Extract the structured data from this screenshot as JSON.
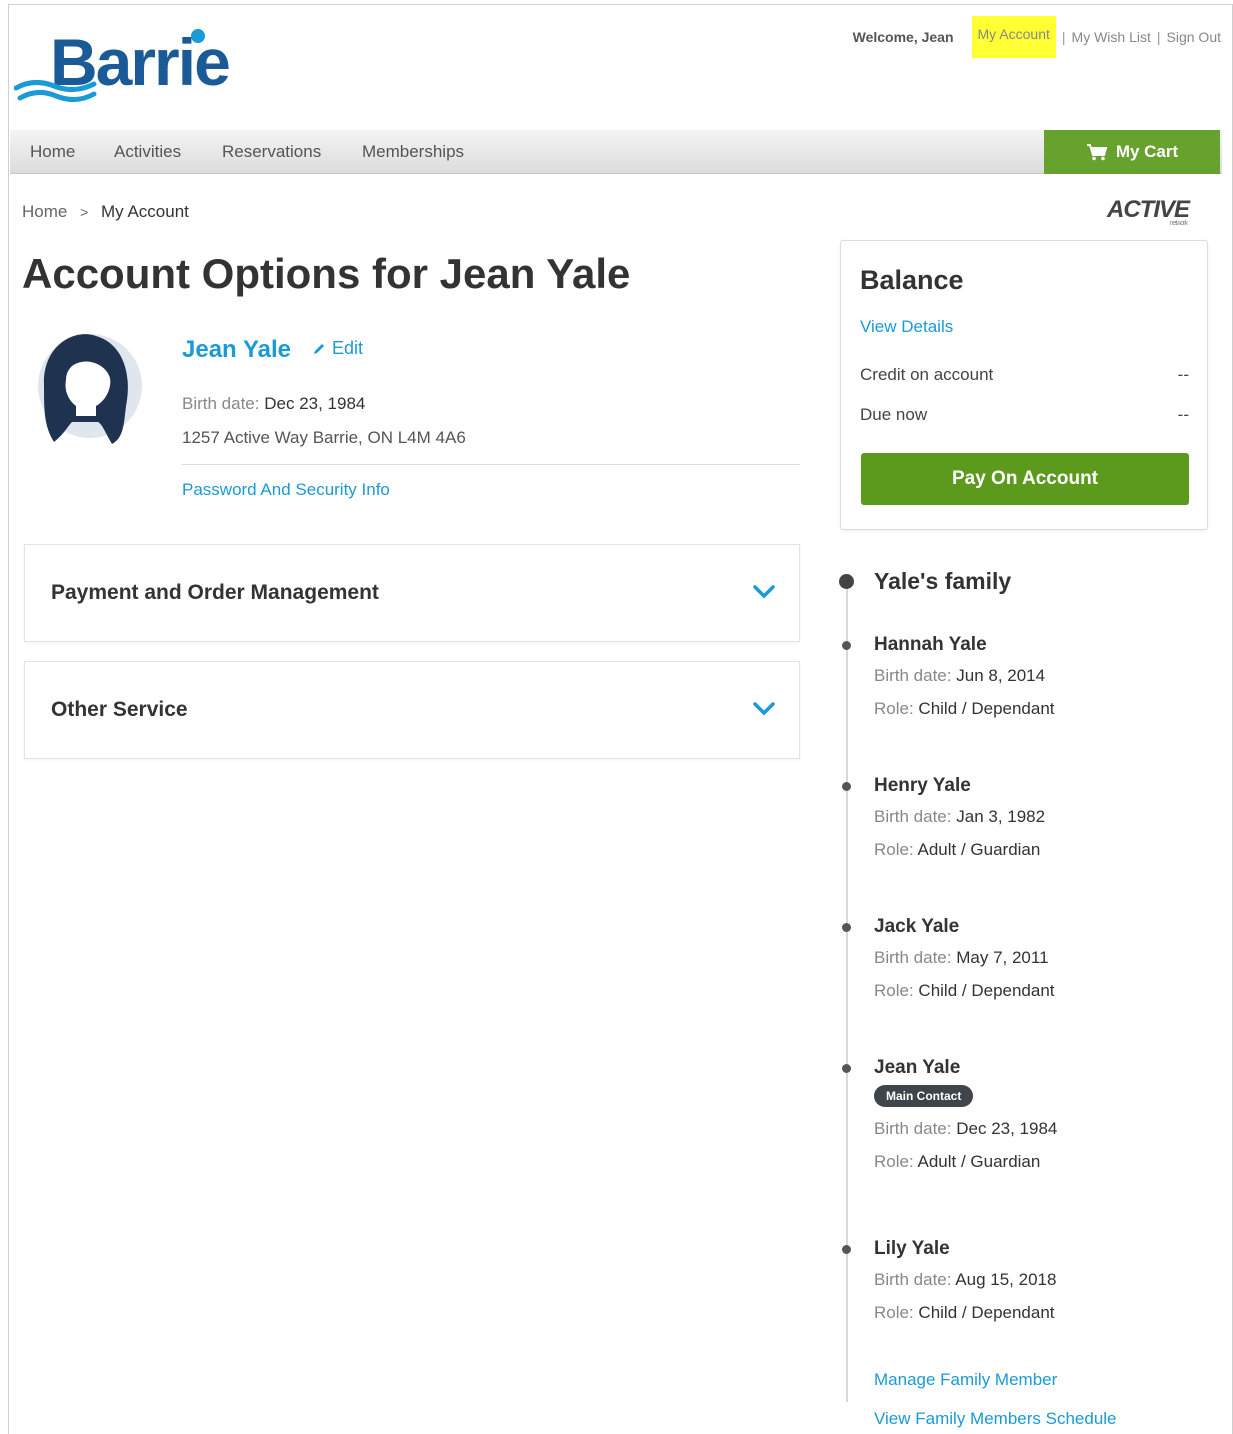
{
  "header": {
    "welcome": "Welcome, Jean",
    "my_account": "My Account",
    "sep1": "|",
    "my_wish_list": "My Wish List",
    "sep2": "|",
    "sign_out": "Sign Out"
  },
  "logo": {
    "text": "Barrie"
  },
  "nav": {
    "items": [
      "Home",
      "Activities",
      "Reservations",
      "Memberships"
    ],
    "cart_label": "My Cart"
  },
  "breadcrumb": {
    "home": "Home",
    "sep": ">",
    "current": "My Account"
  },
  "active_logo": {
    "text": "ACTIVE",
    "sub": "network"
  },
  "page_title": "Account Options for Jean Yale",
  "profile": {
    "name": "Jean Yale",
    "edit_label": "Edit",
    "birth_label": "Birth date:",
    "birth_date": "Dec 23, 1984",
    "address": "1257 Active Way Barrie, ON L4M 4A6",
    "password_link": "Password And Security Info"
  },
  "accordions": [
    {
      "title": "Payment and Order Management"
    },
    {
      "title": "Other Service"
    }
  ],
  "balance": {
    "title": "Balance",
    "view_details": "View Details",
    "credit_label": "Credit on account",
    "credit_value": "--",
    "due_label": "Due now",
    "due_value": "--",
    "pay_button": "Pay On Account"
  },
  "family": {
    "title": "Yale's family",
    "birth_label": "Birth date:",
    "role_label": "Role:",
    "members": [
      {
        "name": "Hannah Yale",
        "birth": "Jun 8, 2014",
        "role": "Child / Dependant"
      },
      {
        "name": "Henry Yale",
        "birth": "Jan 3, 1982",
        "role": "Adult / Guardian"
      },
      {
        "name": "Jack Yale",
        "birth": "May 7, 2011",
        "role": "Child / Dependant"
      },
      {
        "name": "Jean Yale",
        "badge": "Main Contact",
        "birth": "Dec 23, 1984",
        "role": "Adult / Guardian"
      },
      {
        "name": "Lily Yale",
        "birth": "Aug 15, 2018",
        "role": "Child / Dependant"
      }
    ],
    "manage_link": "Manage Family Member",
    "schedule_link": "View Family Members Schedule"
  },
  "colors": {
    "brand_blue": "#1a5a96",
    "link_blue": "#1a9ad6",
    "cart_green": "#67a22f",
    "pay_green": "#5c9a1e",
    "highlight": "#ffff33"
  }
}
